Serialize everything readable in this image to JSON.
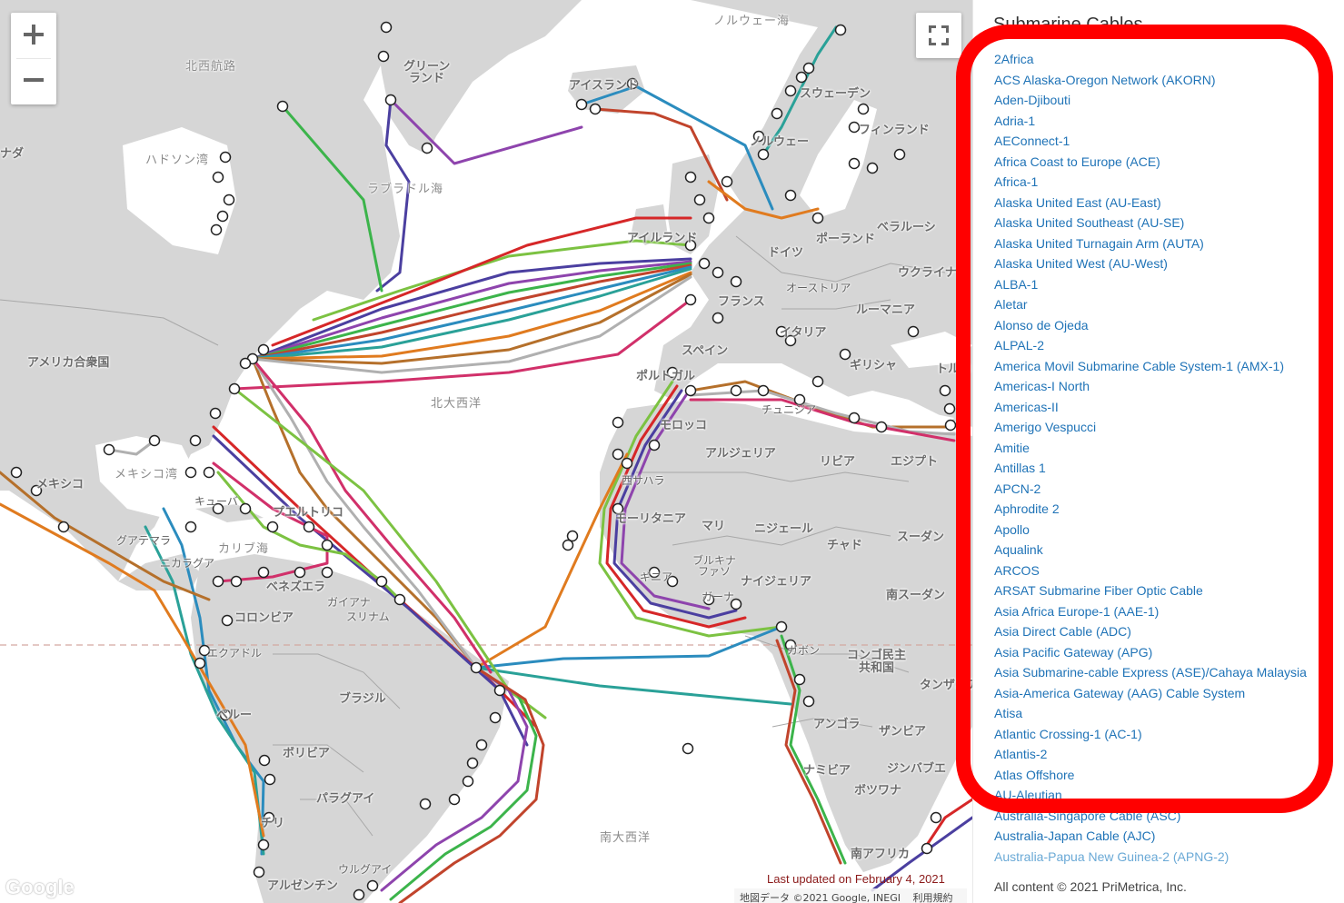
{
  "map": {
    "controls": {
      "zoom_in_label": "+",
      "zoom_out_label": "−",
      "fullscreen_label": "Toggle fullscreen view"
    },
    "labels": {
      "hudson_bay": "ハドソン湾",
      "northwest_passage": "北西航路",
      "canada": "ナダ",
      "greenland_1": "グリーン",
      "greenland_2": "ランド",
      "labrador_sea": "ラブラドル海",
      "iceland": "アイスランド",
      "norwegian_sea": "ノルウェー海",
      "sweden": "スウェーデン",
      "norway": "ノルウェー",
      "finland": "フィンランド",
      "ireland": "アイルランド",
      "germany": "ドイツ",
      "poland": "ポーランド",
      "belarus": "ベラルーシ",
      "ukraine": "ウクライナ",
      "austria": "オーストリア",
      "france": "フランス",
      "romania": "ルーマニア",
      "italy": "イタリア",
      "spain": "スペイン",
      "portugal": "ポルトガル",
      "greece": "ギリシャ",
      "turkey": "トルコ",
      "usa": "アメリカ合衆国",
      "north_atlantic": "北大西洋",
      "tunisia": "チュニジア",
      "morocco": "モロッコ",
      "algeria": "アルジェリア",
      "libya": "リビア",
      "egypt": "エジプト",
      "mexico": "メキシコ",
      "gulf_of_mexico": "メキシコ湾",
      "cuba": "キューバ",
      "western_sahara": "西サハラ",
      "mauritania": "モーリタニア",
      "mali": "マリ",
      "niger": "ニジェール",
      "chad": "チャド",
      "sudan": "スーダン",
      "guatemala": "グアテマラ",
      "caribbean_sea": "カリブ海",
      "puerto_rico": "プエルトリコ",
      "nicaragua": "ニカラグア",
      "burkina_1": "ブルキナ",
      "burkina_2": "ファソ",
      "guinea": "ギニア",
      "nigeria": "ナイジェリア",
      "venezuela": "ベネズエラ",
      "guyana": "ガイアナ",
      "suriname": "スリナム",
      "ghana": "ガーナ",
      "south_sudan": "南スーダン",
      "colombia": "コロンビア",
      "gabon": "ガボン",
      "ecuador": "エクアドル",
      "drc_1": "コンゴ民主",
      "drc_2": "共和国",
      "tanzania": "タンザニア",
      "brazil": "ブラジル",
      "peru": "ペルー",
      "angola": "アンゴラ",
      "zambia": "ザンビア",
      "bolivia": "ボリビア",
      "namibia": "ナミビア",
      "zimbabwe": "ジンバブエ",
      "botswana": "ボツワナ",
      "paraguay": "パラグアイ",
      "chile": "チリ",
      "south_atlantic": "南大西洋",
      "south_africa": "南アフリカ",
      "uruguay": "ウルグアイ",
      "argentina": "アルゼンチン"
    },
    "colors": {
      "land": "#d6d6d6",
      "water": "#ffffff",
      "border": "#a8a8a8",
      "landing_point_fill": "#ffffff",
      "landing_point_stroke": "#222222",
      "cable_palette": [
        "#4b3fa0",
        "#8e44ad",
        "#3cb44b",
        "#c1442c",
        "#2b8cbe",
        "#2aa198",
        "#e07b1f",
        "#b5702b",
        "#b0b0b0",
        "#d1306a",
        "#7cc242",
        "#d62728"
      ]
    },
    "footer": {
      "google_logo": "Google",
      "last_updated": "Last updated on February 4, 2021",
      "map_data": "地図データ ©2021 Google, INEGI",
      "terms": "利用規約"
    }
  },
  "sidebar": {
    "title": "Submarine Cables",
    "cables": [
      "2Africa",
      "ACS Alaska-Oregon Network (AKORN)",
      "Aden-Djibouti",
      "Adria-1",
      "AEConnect-1",
      "Africa Coast to Europe (ACE)",
      "Africa-1",
      "Alaska United East (AU-East)",
      "Alaska United Southeast (AU-SE)",
      "Alaska United Turnagain Arm (AUTA)",
      "Alaska United West (AU-West)",
      "ALBA-1",
      "Aletar",
      "Alonso de Ojeda",
      "ALPAL-2",
      "America Movil Submarine Cable System-1 (AMX-1)",
      "Americas-I North",
      "Americas-II",
      "Amerigo Vespucci",
      "Amitie",
      "Antillas 1",
      "APCN-2",
      "Aphrodite 2",
      "Apollo",
      "Aqualink",
      "ARCOS",
      "ARSAT Submarine Fiber Optic Cable",
      "Asia Africa Europe-1 (AAE-1)",
      "Asia Direct Cable (ADC)",
      "Asia Pacific Gateway (APG)",
      "Asia Submarine-cable Express (ASE)/Cahaya Malaysia",
      "Asia-America Gateway (AAG) Cable System",
      "Atisa",
      "Atlantic Crossing-1 (AC-1)",
      "Atlantis-2",
      "Atlas Offshore",
      "AU-Aleutian",
      "Australia-Singapore Cable (ASC)",
      "Australia-Japan Cable (AJC)",
      "Australia-Papua New Guinea-2 (APNG-2)"
    ],
    "copyright": "All content © 2021 PriMetrica, Inc."
  },
  "annotation": {
    "highlight_color": "#ff0000",
    "highlight_target": "cable-list"
  }
}
